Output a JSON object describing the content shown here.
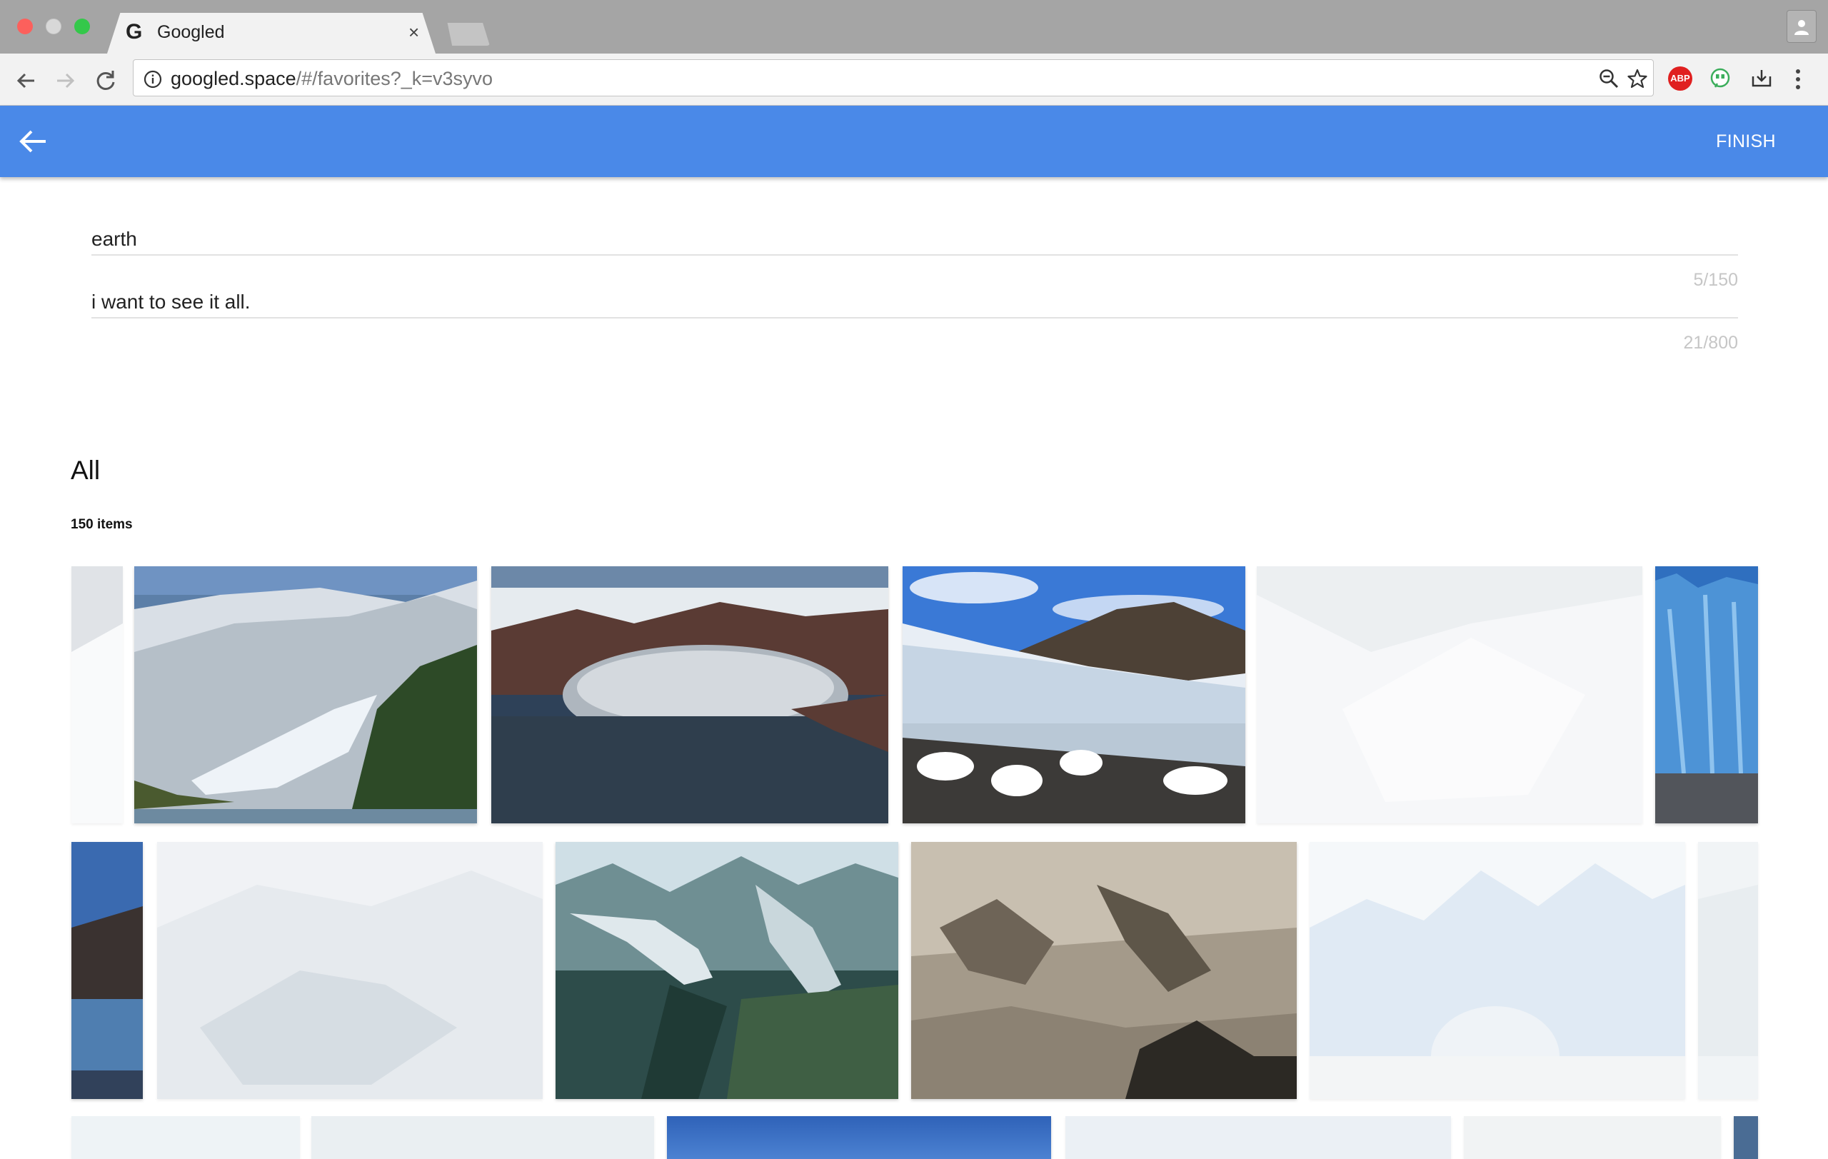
{
  "browser": {
    "tab_title": "Googled",
    "tab_favicon": "G",
    "url_host": "googled.space",
    "url_path": "/#/favorites?_k=v3syvo",
    "abp_label": "ABP",
    "icons": [
      "back-arrow-icon",
      "forward-arrow-icon",
      "reload-icon",
      "info-icon",
      "zoom-out-icon",
      "star-icon",
      "adblock-icon",
      "quote-extension-icon",
      "download-extension-icon",
      "menu-dots-icon",
      "profile-icon"
    ]
  },
  "appbar": {
    "back_icon": "arrow-left-icon",
    "finish_label": "FINISH",
    "color": "#4a89e8"
  },
  "form": {
    "title_value": "earth",
    "title_counter": "5/150",
    "description_value": "i want to see it all.",
    "description_counter": "21/800"
  },
  "gallery": {
    "section_title": "All",
    "item_count": "150 items",
    "rows": [
      [
        {
          "name": "glacier-edge",
          "faded": true
        },
        {
          "name": "valley-glacier",
          "faded": false
        },
        {
          "name": "piedmont-glacier",
          "faded": false
        },
        {
          "name": "ice-front-mountain",
          "faded": false
        },
        {
          "name": "glacier-aerial",
          "faded": true
        },
        {
          "name": "blue-ice-wall",
          "faded": false
        }
      ],
      [
        {
          "name": "glacier-bay-edge",
          "faded": false
        },
        {
          "name": "glacier-valley-haze",
          "faded": true
        },
        {
          "name": "alpine-glacier-aerial",
          "faded": false
        },
        {
          "name": "desert-mountain-aerial",
          "faded": false
        },
        {
          "name": "ice-arch",
          "faded": true
        },
        {
          "name": "ice-edge-right",
          "faded": true
        }
      ],
      [
        {
          "name": "row3-a",
          "faded": true
        },
        {
          "name": "row3-b",
          "faded": true
        },
        {
          "name": "row3-c",
          "faded": false
        },
        {
          "name": "row3-d",
          "faded": true
        },
        {
          "name": "row3-e",
          "faded": true
        },
        {
          "name": "row3-f",
          "faded": false
        }
      ]
    ]
  }
}
